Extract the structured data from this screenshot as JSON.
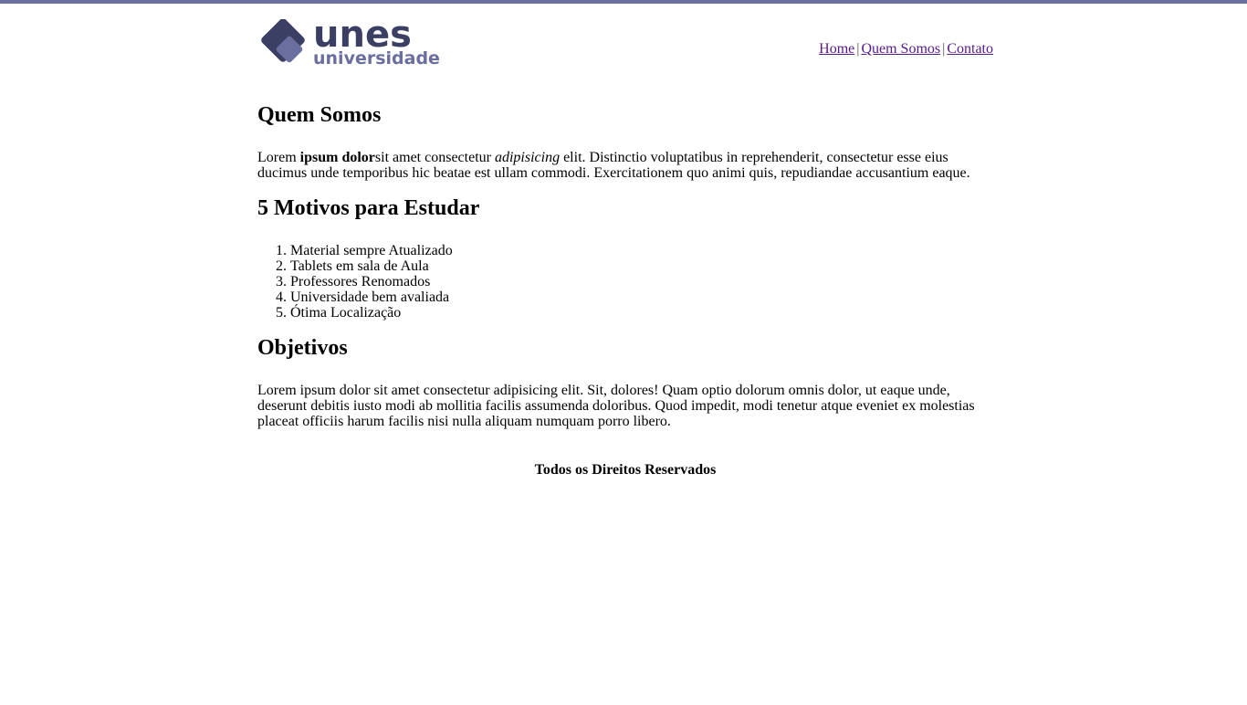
{
  "brand": {
    "logo_word": "unes",
    "logo_sub": "universidade",
    "colors": {
      "dark": "#3b3f63",
      "light": "#6a6fa0",
      "topbar": "#6a6fa0",
      "link_visited": "#551a8b"
    }
  },
  "nav": {
    "items": [
      {
        "label": "Home"
      },
      {
        "label": "Quem Somos"
      },
      {
        "label": "Contato"
      }
    ],
    "separator": "|"
  },
  "sections": {
    "quem_somos": {
      "title": "Quem Somos",
      "text_prefix": "Lorem ",
      "text_bold": "ipsum dolor",
      "text_mid": "sit amet consectetur ",
      "text_italic": "adipisicing",
      "text_suffix": " elit. Distinctio voluptatibus in reprehenderit, consectetur esse eius ducimus unde temporibus hic beatae est ullam commodi. Exercitationem quo animi quis, repudiandae accusantium eaque."
    },
    "motivos": {
      "title": "5 Motivos para Estudar",
      "items": [
        "Material sempre Atualizado",
        "Tablets em sala de Aula",
        "Professores Renomados",
        "Universidade bem avaliada",
        "Ótima Localização"
      ]
    },
    "objetivos": {
      "title": "Objetivos",
      "text": "Lorem ipsum dolor sit amet consectetur adipisicing elit. Sit, dolores! Quam optio dolorum omnis dolor, ut eaque unde, deserunt debitis iusto modi ab mollitia facilis assumenda doloribus. Quod impedit, modi tenetur atque eveniet ex molestias placeat officiis harum facilis nisi nulla aliquam numquam porro libero."
    }
  },
  "footer": {
    "text": "Todos os Direitos Reservados"
  }
}
